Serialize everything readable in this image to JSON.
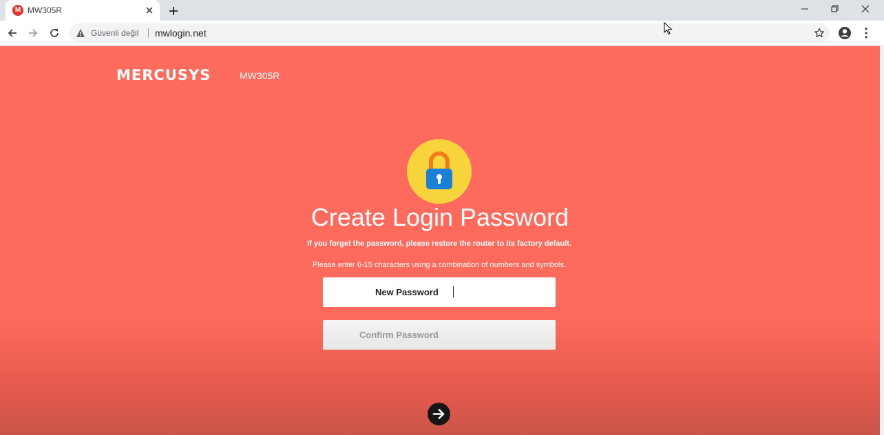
{
  "browser": {
    "tab": {
      "title": "MW305R",
      "favicon_letter": "M",
      "favicon_icon": "mercusys-favicon-icon"
    },
    "toolbar": {
      "security_label": "Güvenli değil",
      "url": "mwlogin.net"
    }
  },
  "page": {
    "brand": "MERCUSYS",
    "model": "MW305R",
    "lock_icon": "lock-icon",
    "heading": "Create Login Password",
    "notice": "If you forget the password, please restore the router to its factory default.",
    "hint": "Please enter 6-15 characters using a combination of numbers and symbols.",
    "new_password_label": "New Password",
    "confirm_password_label": "Confirm Password",
    "next_icon": "arrow-right-icon"
  },
  "colors": {
    "page_background": "#ff6b5c",
    "lock_circle": "#f7d43c",
    "lock_shackle": "#f07c1e",
    "lock_body": "#1a7fd6",
    "next_button": "#161616",
    "favicon": "#e0342c"
  }
}
